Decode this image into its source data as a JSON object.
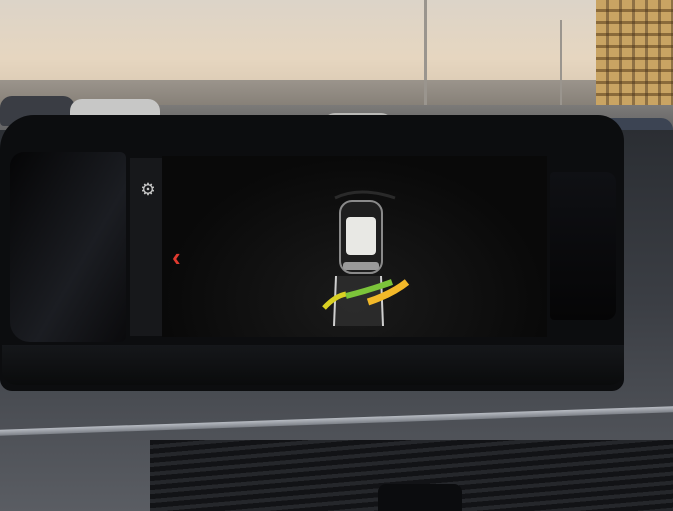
{
  "scene": {
    "description_colors": {
      "sky": "#dcd4c8",
      "dashboard": "#2b2e33",
      "screen": "#090909"
    }
  },
  "display": {
    "settings_icon": "gear-icon",
    "back_icon": "chevron-left-icon",
    "back_color": "#e03a2f",
    "parking_zones": [
      {
        "side": "left",
        "color": "#d9d023"
      },
      {
        "side": "center",
        "color": "#7cc43a"
      },
      {
        "side": "right",
        "color": "#f2b829"
      }
    ]
  }
}
